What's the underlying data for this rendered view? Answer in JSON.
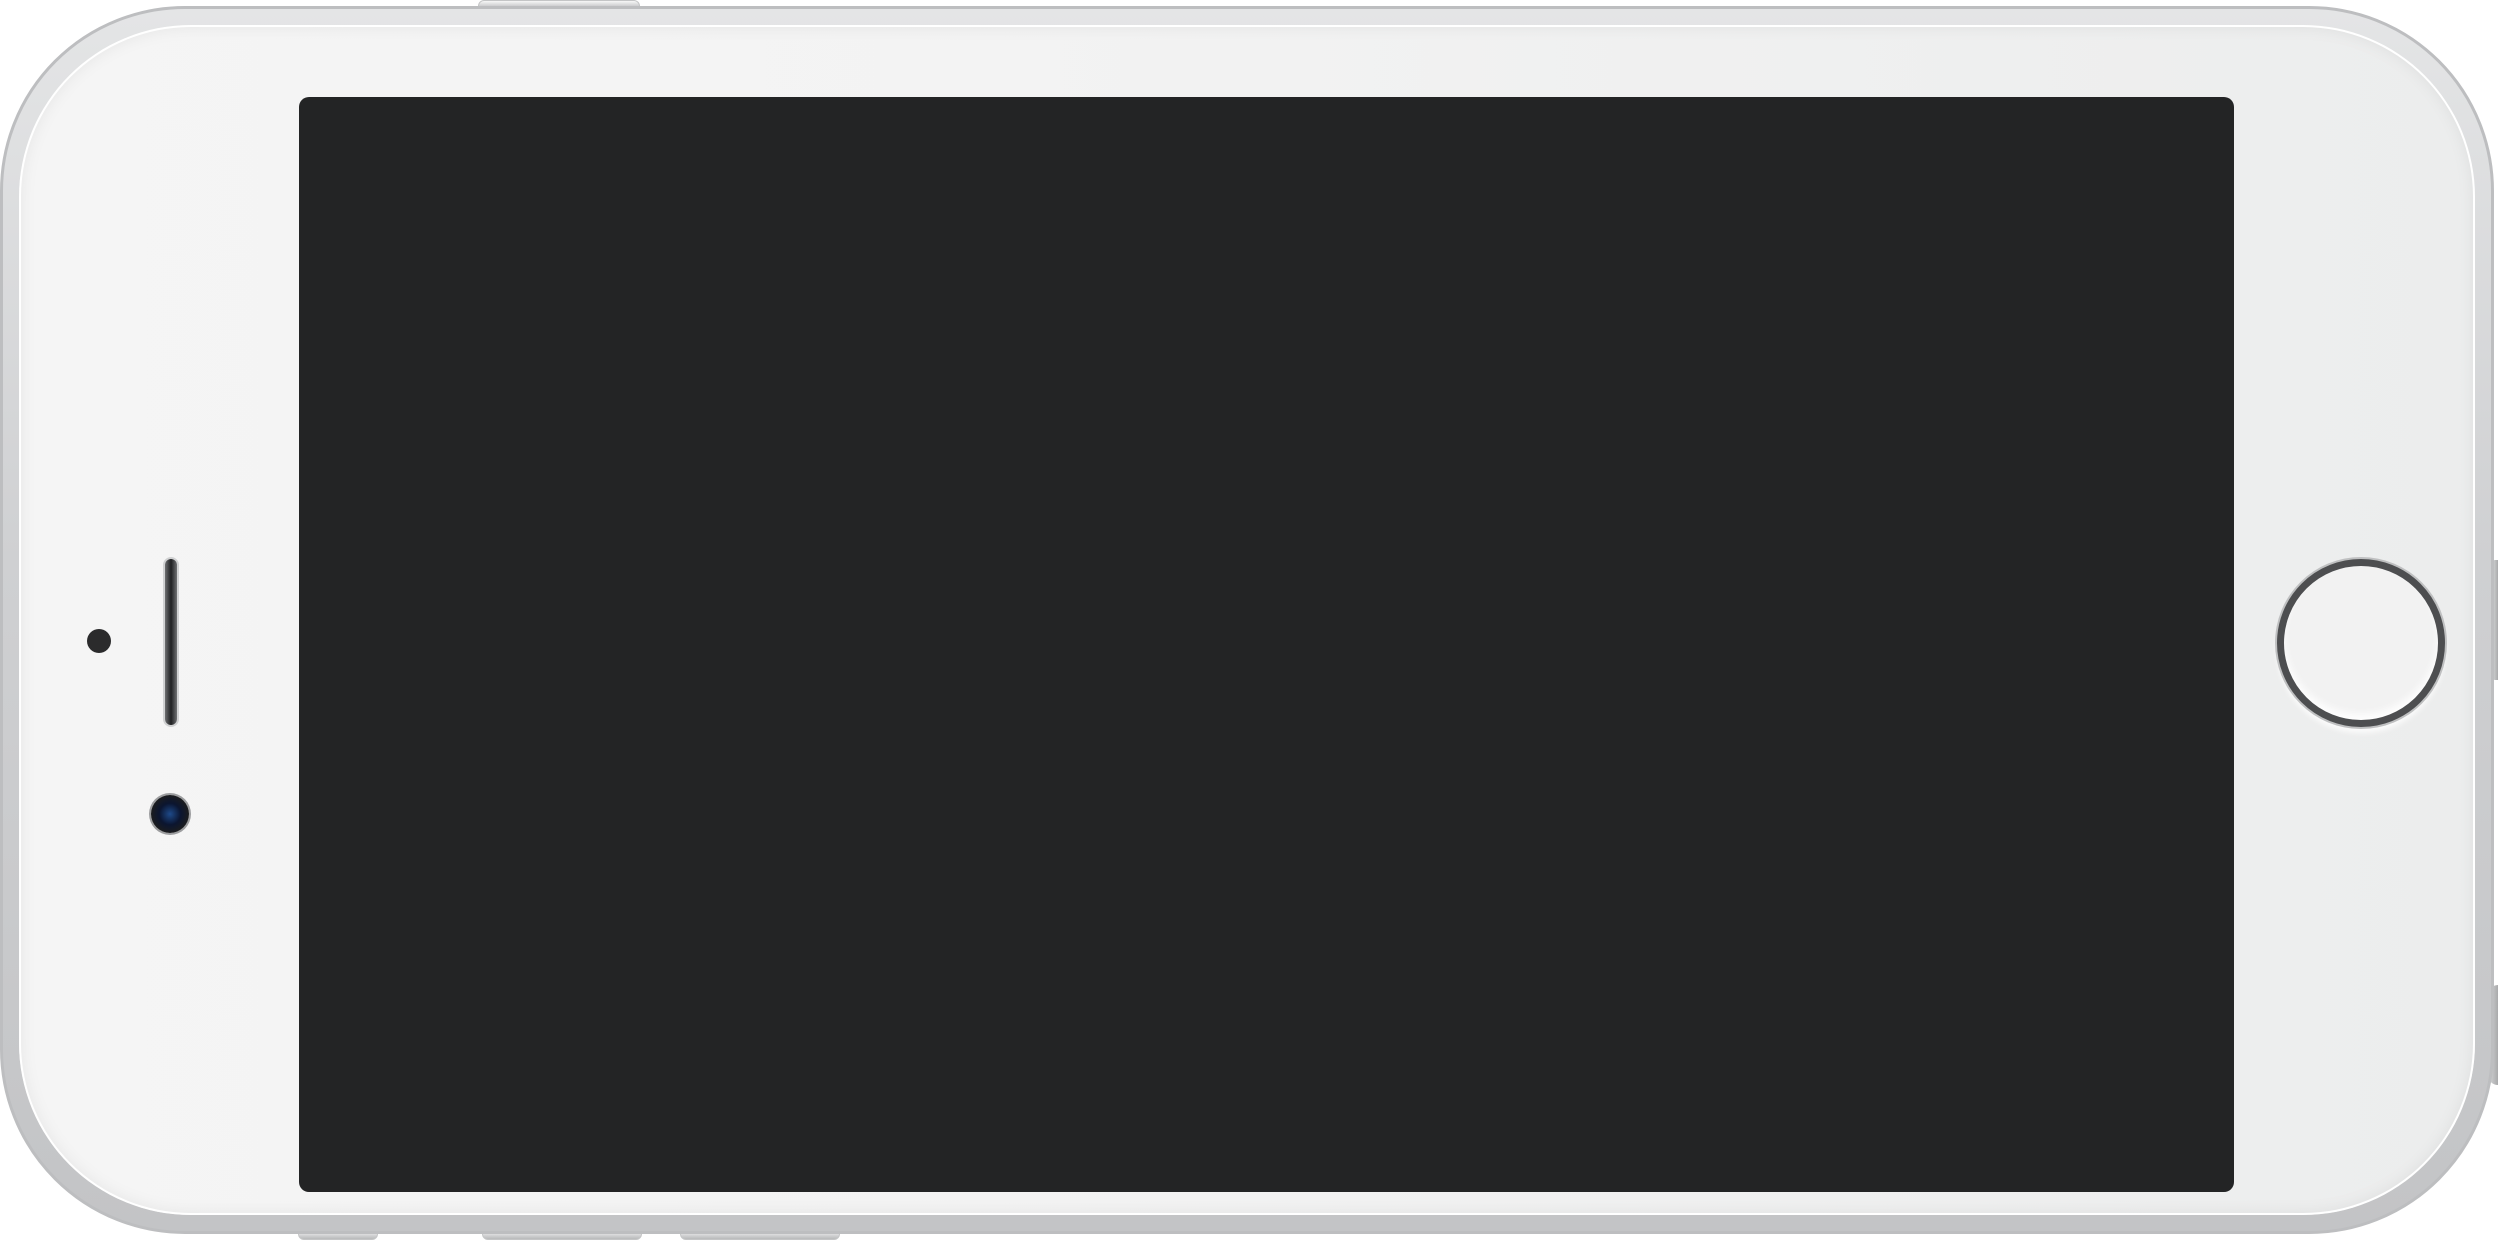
{
  "device": {
    "type": "smartphone",
    "orientation": "landscape",
    "finish": "silver",
    "screen": {
      "state": "off",
      "content": ""
    }
  },
  "colors": {
    "screen": "#232425",
    "body": "#f3f3f3",
    "frame": "#cfd0d2",
    "home_ring": "#4d4e50"
  },
  "icons": {
    "home_button": "home-button-ring",
    "front_camera": "camera-lens",
    "earpiece": "speaker-slot",
    "sensor": "proximity-sensor-dot"
  }
}
